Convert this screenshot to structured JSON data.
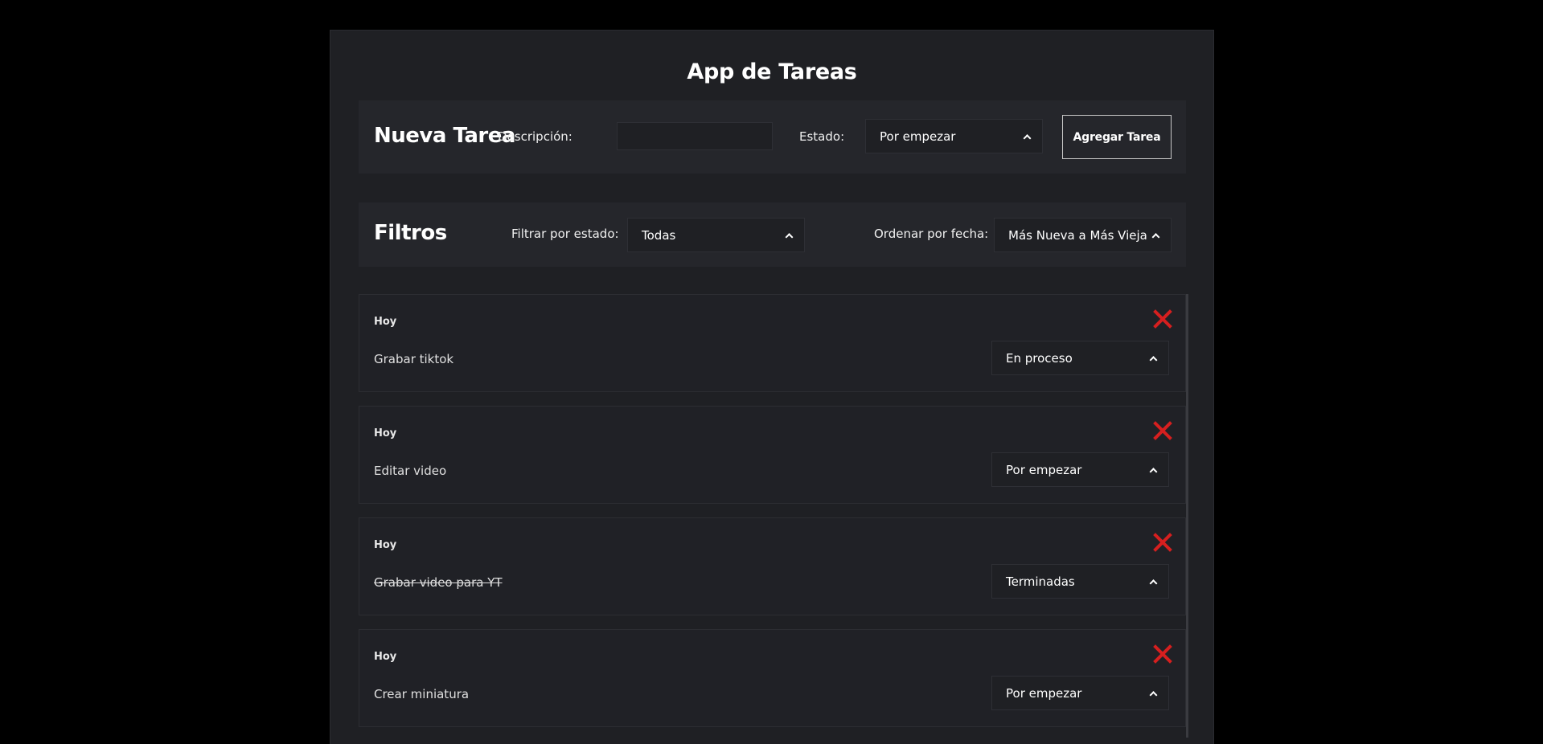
{
  "app": {
    "title": "App de Tareas"
  },
  "new_task": {
    "heading": "Nueva Tarea",
    "description_label": "Descripción:",
    "description_value": "",
    "status_label": "Estado:",
    "status_value": "Por empezar",
    "add_button": "Agregar Tarea"
  },
  "filters": {
    "heading": "Filtros",
    "status_label": "Filtrar por estado:",
    "status_value": "Todas",
    "sort_label": "Ordenar por fecha:",
    "sort_value": "Más Nueva a Más Vieja"
  },
  "tasks": [
    {
      "date": "Hoy",
      "description": "Grabar tiktok",
      "status": "En proceso",
      "done": false
    },
    {
      "date": "Hoy",
      "description": "Editar video",
      "status": "Por empezar",
      "done": false
    },
    {
      "date": "Hoy",
      "description": "Grabar video para YT",
      "status": "Terminadas",
      "done": true
    },
    {
      "date": "Hoy",
      "description": "Crear miniatura",
      "status": "Por empezar",
      "done": false
    }
  ],
  "colors": {
    "delete": "#d61f1f",
    "background": "#000000",
    "container": "#1f2024",
    "panel": "#25262b"
  },
  "icons": {
    "delete": "close-icon",
    "dropdown": "chevron-up-icon"
  }
}
